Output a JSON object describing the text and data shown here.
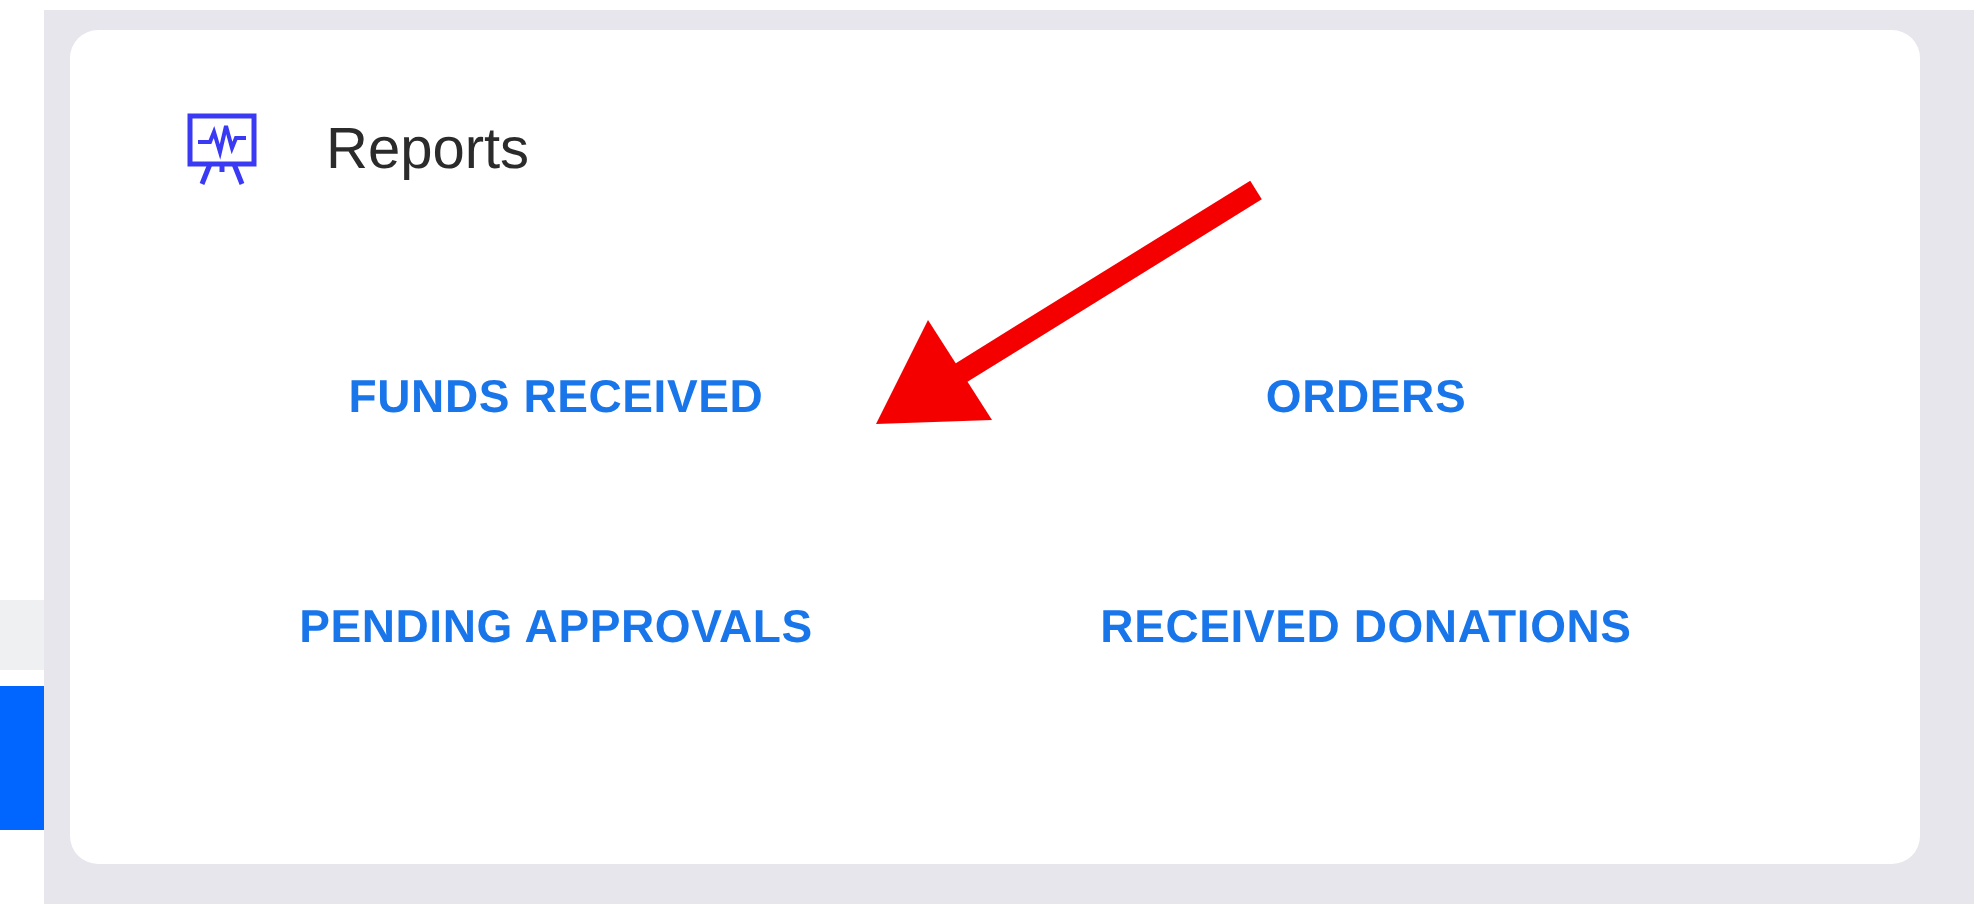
{
  "card": {
    "title": "Reports"
  },
  "links": [
    {
      "label": "FUNDS RECEIVED"
    },
    {
      "label": "ORDERS"
    },
    {
      "label": "PENDING APPROVALS"
    },
    {
      "label": "RECEIVED DONATIONS"
    }
  ]
}
